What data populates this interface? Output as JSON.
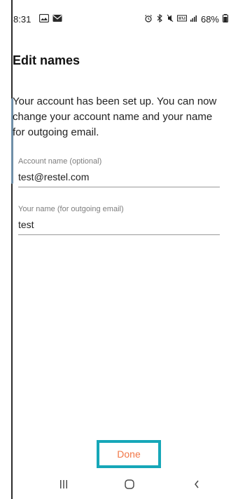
{
  "status_bar": {
    "time": "8:31",
    "battery_percent": "68%",
    "left_icons": [
      "gallery-icon",
      "mail-icon"
    ],
    "right_icons": [
      "alarm-icon",
      "bluetooth-icon",
      "mute-icon",
      "volte-icon",
      "signal-icon",
      "battery-icon"
    ]
  },
  "screen": {
    "title": "Edit names",
    "description": "Your account has been set up. You can now change your account name and your name for outgoing email."
  },
  "fields": {
    "account_name": {
      "label": "Account name (optional)",
      "value": "test@restel.com"
    },
    "your_name": {
      "label": "Your name (for outgoing email)",
      "value": "test"
    }
  },
  "actions": {
    "done_label": "Done"
  },
  "nav_bar": {
    "buttons": [
      "recents-icon",
      "home-icon",
      "back-icon"
    ]
  },
  "colors": {
    "accent": "#f17646",
    "highlight_border": "#16a7b8",
    "edge_tab": "#6f8fa8"
  }
}
